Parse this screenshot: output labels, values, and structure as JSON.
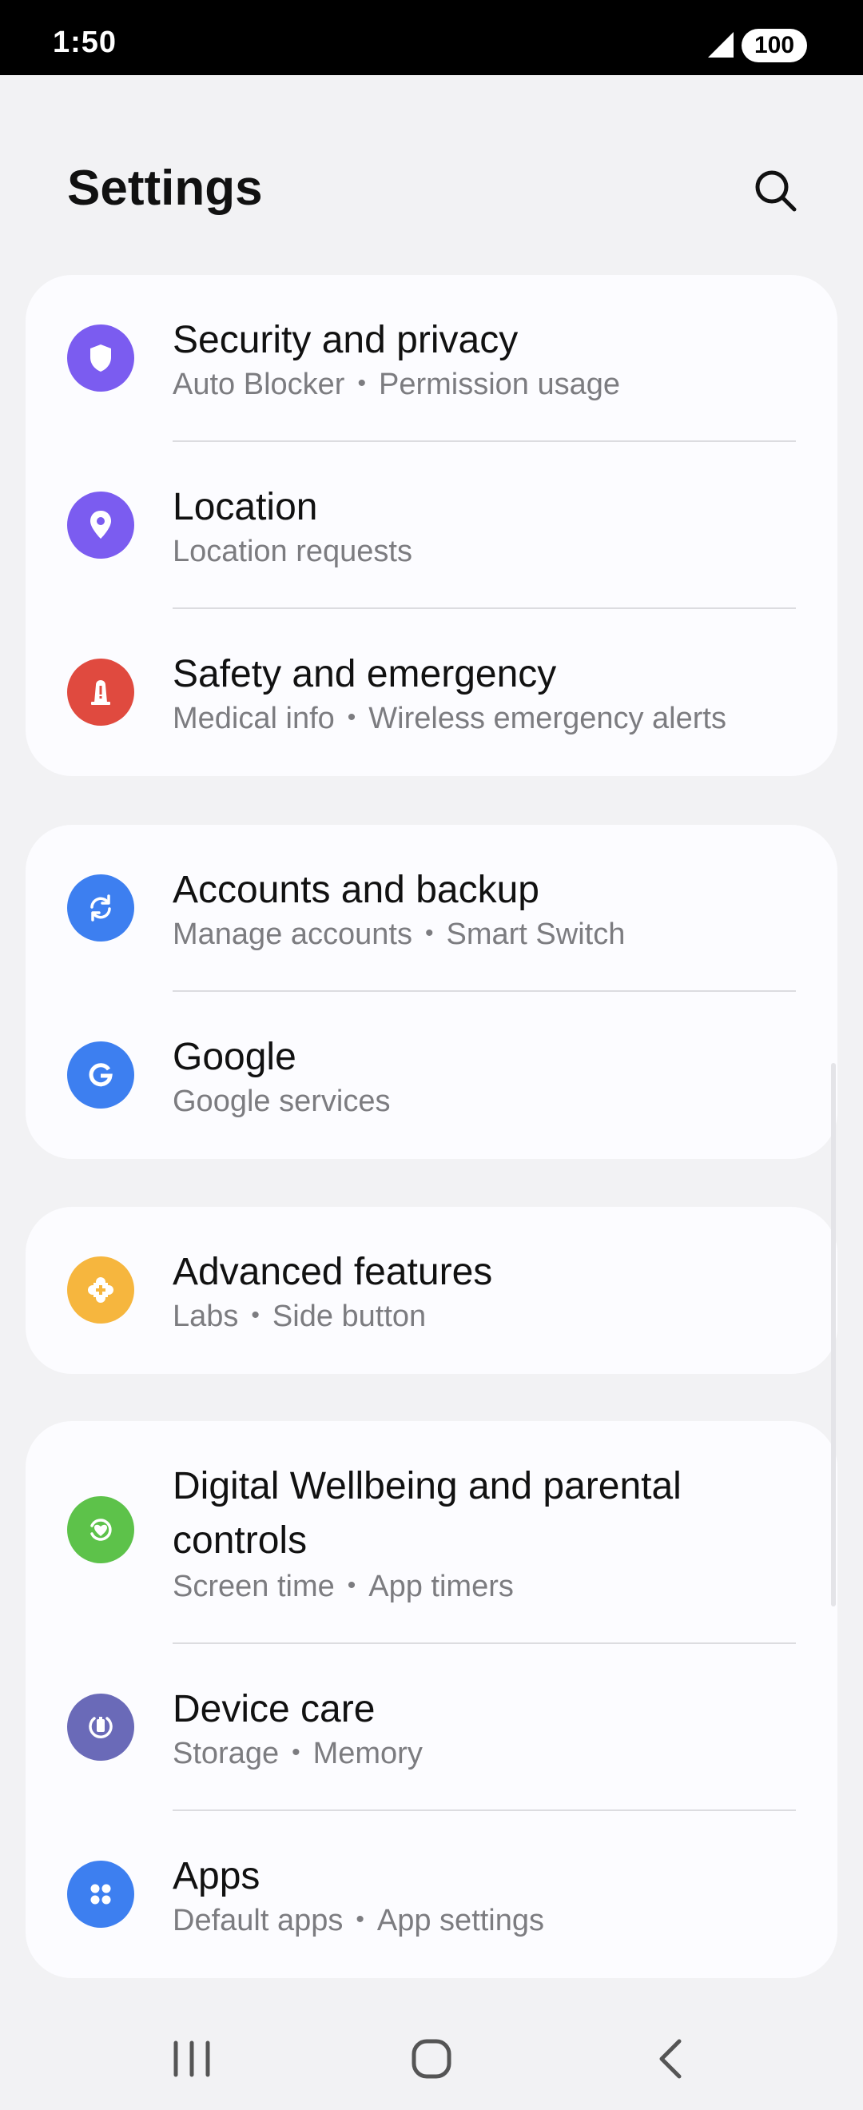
{
  "status_bar": {
    "time": "1:50",
    "battery": "100"
  },
  "header": {
    "title": "Settings",
    "search_icon": "search-icon"
  },
  "groups": [
    {
      "items": [
        {
          "title": "Security and privacy",
          "subtitle": [
            "Auto Blocker",
            "Permission usage"
          ],
          "icon": "shield-icon",
          "color": "#7b5cf0"
        },
        {
          "title": "Location",
          "subtitle": [
            "Location requests"
          ],
          "icon": "location-pin-icon",
          "color": "#7b5cf0"
        },
        {
          "title": "Safety and emergency",
          "subtitle": [
            "Medical info",
            "Wireless emergency alerts"
          ],
          "icon": "emergency-icon",
          "color": "#e04a3f"
        }
      ]
    },
    {
      "items": [
        {
          "title": "Accounts and backup",
          "subtitle": [
            "Manage accounts",
            "Smart Switch"
          ],
          "icon": "sync-icon",
          "color": "#3d7ff0"
        },
        {
          "title": "Google",
          "subtitle": [
            "Google services"
          ],
          "icon": "google-icon",
          "color": "#3d7ff0"
        }
      ]
    },
    {
      "items": [
        {
          "title": "Advanced features",
          "subtitle": [
            "Labs",
            "Side button"
          ],
          "icon": "puzzle-icon",
          "color": "#f6b63e"
        }
      ]
    },
    {
      "items": [
        {
          "title": "Digital Wellbeing and parental controls",
          "subtitle": [
            "Screen time",
            "App timers"
          ],
          "icon": "wellbeing-icon",
          "color": "#5dc24a"
        },
        {
          "title": "Device care",
          "subtitle": [
            "Storage",
            "Memory"
          ],
          "icon": "device-care-icon",
          "color": "#6a6ab8"
        },
        {
          "title": "Apps",
          "subtitle": [
            "Default apps",
            "App settings"
          ],
          "icon": "apps-icon",
          "color": "#3d7ff0"
        }
      ]
    }
  ],
  "nav_bar": {
    "icons": [
      "recent-apps-icon",
      "home-icon",
      "back-icon"
    ]
  },
  "sub_separator": "•"
}
